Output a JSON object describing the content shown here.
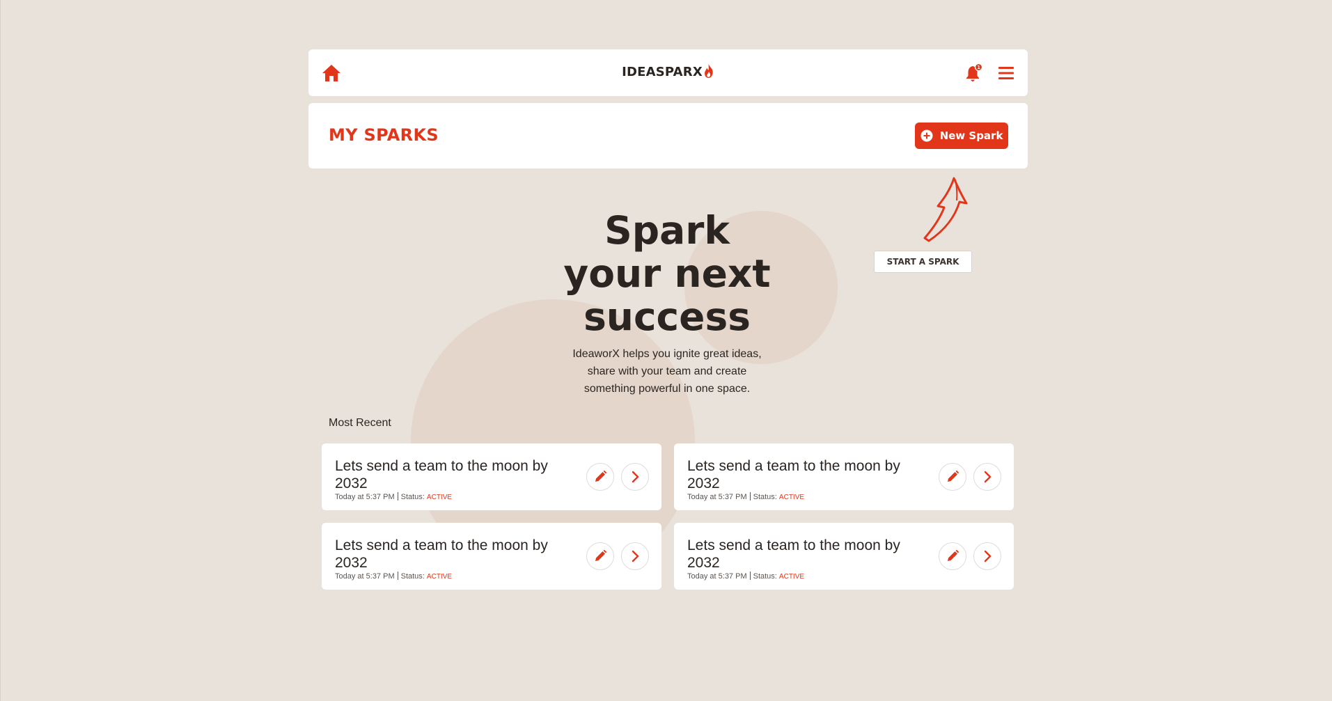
{
  "colors": {
    "accent": "#e2361b",
    "background": "#e9e2db",
    "card": "#ffffff",
    "text": "#2b2522"
  },
  "topbar": {
    "brand": "IDEASPARX",
    "home_icon": "home-icon",
    "notification_icon": "bell-icon",
    "notification_count": "1",
    "menu_icon": "hamburger-icon"
  },
  "header": {
    "title": "MY SPARKS",
    "new_button_label": "New Spark",
    "new_button_icon": "plus-circle-icon"
  },
  "callout": {
    "label": "START A SPARK"
  },
  "hero": {
    "headline": "Spark\nyour next\nsuccess",
    "description": "IdeaworX helps you ignite great ideas, share with your team and create something powerful in one space."
  },
  "recent": {
    "label": "Most Recent",
    "items": [
      {
        "title": "Lets send a team to the moon by 2032",
        "time": "Today at 5:37 PM",
        "status_label": "Status:",
        "status": "ACTIVE"
      },
      {
        "title": "Lets send a team to the moon by 2032",
        "time": "Today at 5:37 PM",
        "status_label": "Status:",
        "status": "ACTIVE"
      },
      {
        "title": "Lets send a team to the moon by 2032",
        "time": "Today at 5:37 PM",
        "status_label": "Status:",
        "status": "ACTIVE"
      },
      {
        "title": "Lets send a team to the moon by 2032",
        "time": "Today at 5:37 PM",
        "status_label": "Status:",
        "status": "ACTIVE"
      }
    ]
  }
}
